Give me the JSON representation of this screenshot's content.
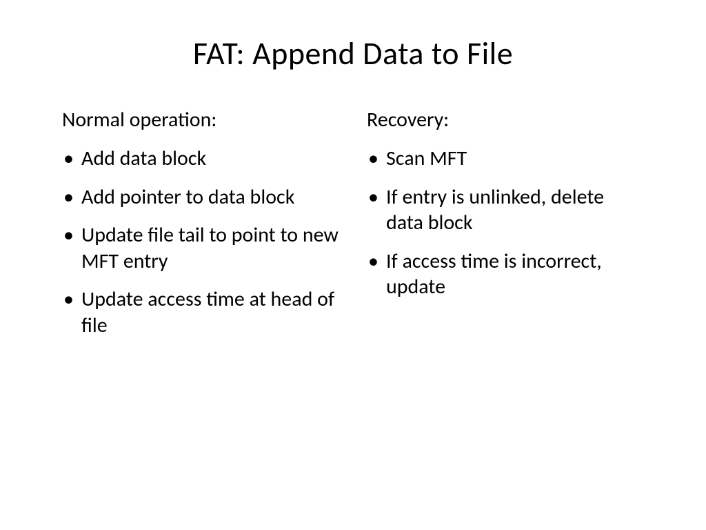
{
  "slide": {
    "title": "FAT: Append Data to File",
    "left": {
      "heading": "Normal operation:",
      "items": [
        "Add data block",
        "Add pointer to data block",
        "Update file tail to point to new MFT entry",
        "Update access time at head of file"
      ]
    },
    "right": {
      "heading": "Recovery:",
      "items": [
        "Scan MFT",
        "If entry is unlinked, delete data block",
        "If access time is incorrect, update"
      ]
    }
  }
}
